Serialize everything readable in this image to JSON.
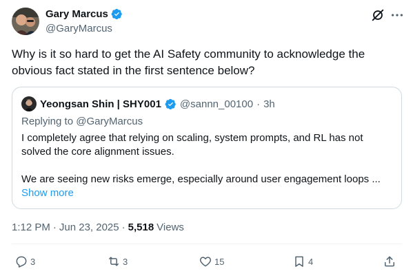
{
  "author": {
    "display_name": "Gary Marcus",
    "handle": "@GaryMarcus",
    "avatar_icon": "avatar-photo"
  },
  "tweet": {
    "text": "Why is it so hard to get the AI Safety community to acknowledge the obvious fact stated in the first sentence below?"
  },
  "quote": {
    "display_name": "Yeongsan Shin | SHY001",
    "handle": "@sannn_00100",
    "separator": "·",
    "time": "3h",
    "replying_to_label": "Replying to",
    "replying_to_handle": "@GaryMarcus",
    "paragraph1": "I completely agree that relying on scaling, system prompts, and RL has not solved the core alignment issues.",
    "paragraph2": "We are seeing new risks emerge, especially around user engagement loops ...",
    "show_more": "Show more"
  },
  "meta": {
    "time": "1:12 PM",
    "sep1": "·",
    "date": "Jun 23, 2025",
    "sep2": "·",
    "views_count": "5,518",
    "views_label": "Views"
  },
  "actions": {
    "replies": "3",
    "reposts": "3",
    "likes": "15",
    "bookmarks": "4"
  },
  "colors": {
    "accent": "#1d9bf0",
    "text": "#0f1419",
    "secondary": "#536471",
    "border": "#cfd9de"
  }
}
